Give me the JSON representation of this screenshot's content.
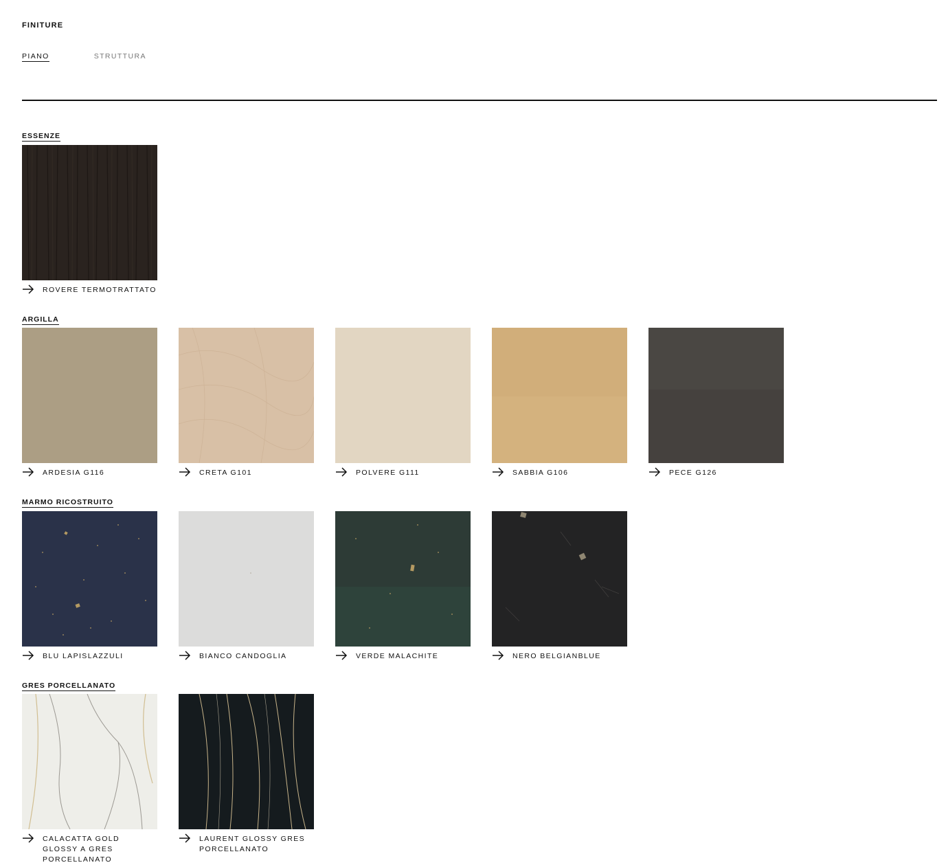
{
  "header": {
    "title": "FINITURE"
  },
  "tabs": [
    {
      "label": "PIANO",
      "active": true
    },
    {
      "label": "STRUTTURA",
      "active": false
    }
  ],
  "sections": [
    {
      "title": "ESSENZE",
      "items": [
        {
          "label": "ROVERE TERMOTRATTATO",
          "color": "#2a231f"
        }
      ]
    },
    {
      "title": "ARGILLA",
      "items": [
        {
          "label": "ARDESIA G116",
          "color": "#a89a80"
        },
        {
          "label": "CRETA G101",
          "color": "#d8c0a6"
        },
        {
          "label": "POLVERE G111",
          "color": "#e2d6c2"
        },
        {
          "label": "SABBIA G106",
          "color": "#d4b27e"
        },
        {
          "label": "PECE G126",
          "color": "#4a4743"
        }
      ]
    },
    {
      "title": "MARMO RICOSTRUITO",
      "items": [
        {
          "label": "BLU LAPISLAZZULI",
          "color": "#2a3249"
        },
        {
          "label": "BIANCO CANDOGLIA",
          "color": "#dcdcdb"
        },
        {
          "label": "VERDE MALACHITE",
          "color": "#2d3b36"
        },
        {
          "label": "NERO BELGIANBLUE",
          "color": "#232324"
        }
      ]
    },
    {
      "title": "GRES PORCELLANATO",
      "items": [
        {
          "label": "CALACATTA GOLD GLOSSY A GRES PORCELLANATO",
          "color": "#eeeee9"
        },
        {
          "label": "LAURENT GLOSSY GRES PORCELLANATO",
          "color": "#151b1e"
        }
      ]
    }
  ]
}
